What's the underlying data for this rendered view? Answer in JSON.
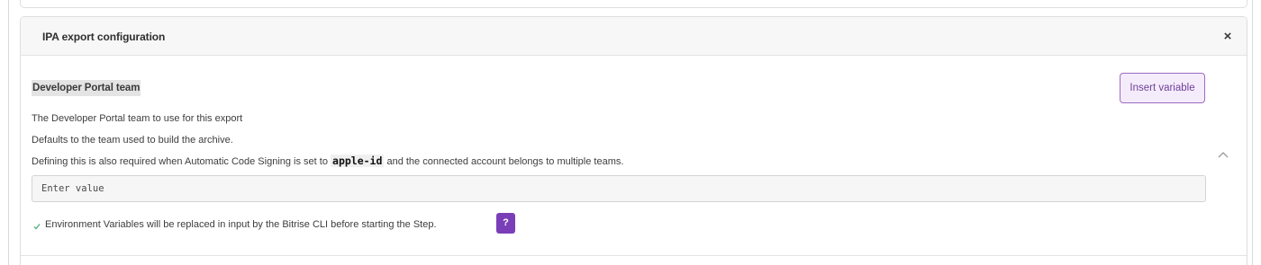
{
  "panel": {
    "title": "IPA export configuration",
    "close_glyph": "×",
    "close_icon": "close-icon"
  },
  "field": {
    "label": "Developer Portal team",
    "insert_variable_label": "Insert variable",
    "description_line1": "The Developer Portal team to use for this export",
    "description_line2": "Defaults to the team used to build the archive.",
    "description_line3_prefix": "Defining this is also required when Automatic Code Signing is set to ",
    "description_line3_code": "apple-id",
    "description_line3_suffix": " and the connected account belongs to multiple teams.",
    "collapse_icon": "chevron-up-icon",
    "input_value": "",
    "input_placeholder": "Enter value"
  },
  "env_note": {
    "text": "Environment Variables will be replaced in input by the Bitrise CLI before starting the Step.",
    "check_icon": "check-icon",
    "help_label": "?"
  },
  "colors": {
    "accent_purple": "#7a3fb8",
    "insert_border": "#9d6bc3",
    "insert_bg": "#f5ecfb",
    "check_green": "#4caf7a"
  }
}
